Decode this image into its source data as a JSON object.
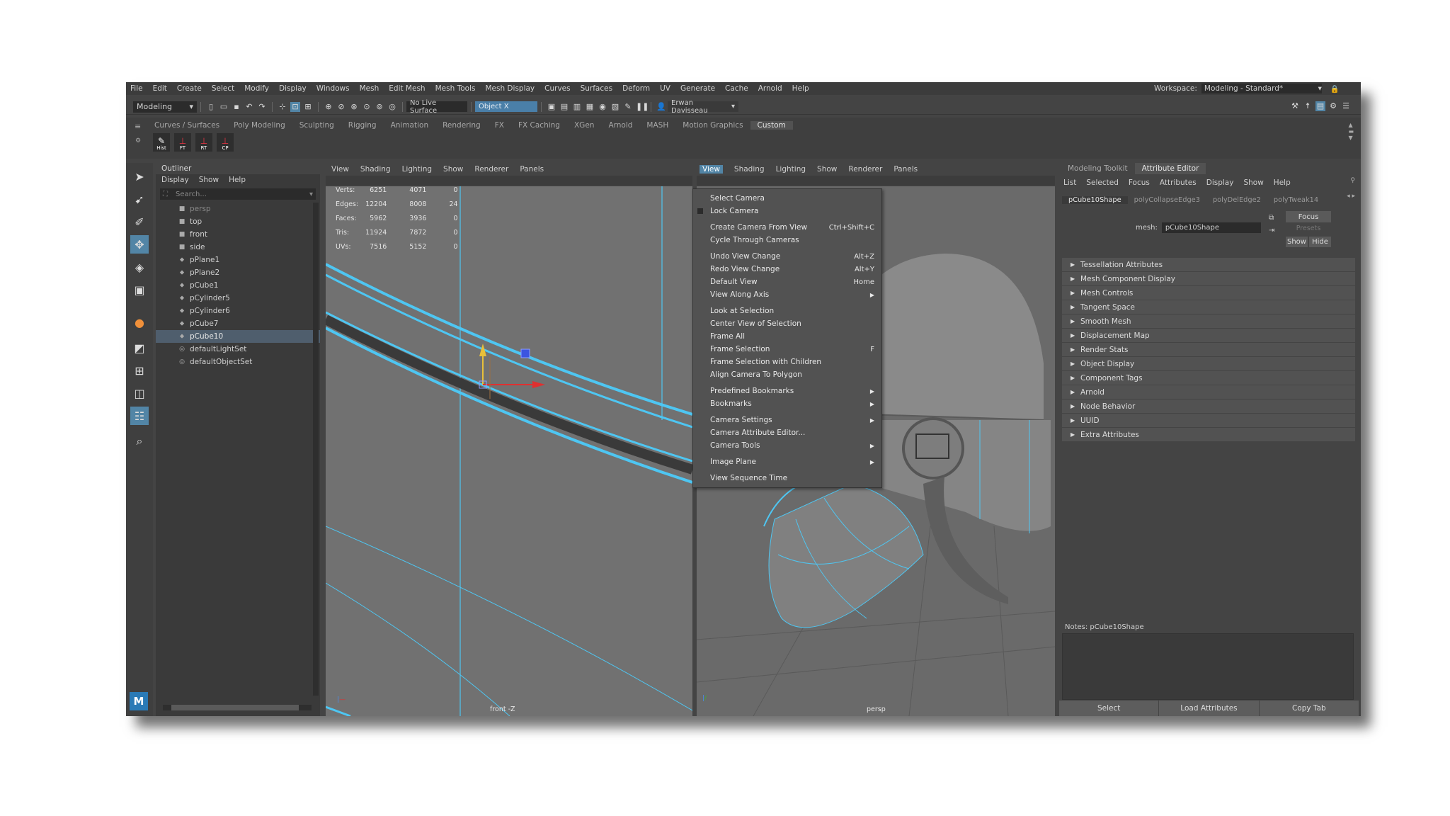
{
  "menubar": [
    "File",
    "Edit",
    "Create",
    "Select",
    "Modify",
    "Display",
    "Windows",
    "Mesh",
    "Edit Mesh",
    "Mesh Tools",
    "Mesh Display",
    "Curves",
    "Surfaces",
    "Deform",
    "UV",
    "Generate",
    "Cache",
    "Arnold",
    "Help"
  ],
  "workspace": {
    "label": "Workspace:",
    "value": "Modeling - Standard*"
  },
  "statusline": {
    "menuset": "Modeling",
    "live_surface": "No Live Surface",
    "symmetry": "Object X",
    "user": "Erwan Davisseau"
  },
  "shelf": {
    "tabs": [
      "Curves / Surfaces",
      "Poly Modeling",
      "Sculpting",
      "Rigging",
      "Animation",
      "Rendering",
      "FX",
      "FX Caching",
      "XGen",
      "Arnold",
      "MASH",
      "Motion Graphics",
      "Custom"
    ],
    "buttons": [
      "Hist",
      "FT",
      "RT",
      "CP"
    ]
  },
  "outliner": {
    "title": "Outliner",
    "menu": [
      "Display",
      "Show",
      "Help"
    ],
    "search_placeholder": "Search...",
    "items": [
      "persp",
      "top",
      "front",
      "side",
      "pPlane1",
      "pPlane2",
      "pCube1",
      "pCylinder5",
      "pCylinder6",
      "pCube7",
      "pCube10",
      "defaultLightSet",
      "defaultObjectSet"
    ]
  },
  "viewport_left": {
    "menu": [
      "View",
      "Shading",
      "Lighting",
      "Show",
      "Renderer",
      "Panels"
    ],
    "hud": [
      {
        "label": "Verts:",
        "a": "6251",
        "b": "4071",
        "c": "0"
      },
      {
        "label": "Edges:",
        "a": "12204",
        "b": "8008",
        "c": "24"
      },
      {
        "label": "Faces:",
        "a": "5962",
        "b": "3936",
        "c": "0"
      },
      {
        "label": "Tris:",
        "a": "11924",
        "b": "7872",
        "c": "0"
      },
      {
        "label": "UVs:",
        "a": "7516",
        "b": "5152",
        "c": "0"
      }
    ],
    "camera_label": "front -Z"
  },
  "viewport_right": {
    "menu": [
      "View",
      "Shading",
      "Lighting",
      "Show",
      "Renderer",
      "Panels"
    ],
    "camera_label": "persp"
  },
  "view_menu": {
    "groups": [
      [
        {
          "label": "Select Camera",
          "shortcut": ""
        },
        {
          "label": "Lock Camera",
          "shortcut": ""
        }
      ],
      [
        {
          "label": "Create Camera From View",
          "shortcut": "Ctrl+Shift+C"
        },
        {
          "label": "Cycle Through Cameras",
          "shortcut": ""
        }
      ],
      [
        {
          "label": "Undo View Change",
          "shortcut": "Alt+Z"
        },
        {
          "label": "Redo View Change",
          "shortcut": "Alt+Y"
        },
        {
          "label": "Default View",
          "shortcut": "Home"
        },
        {
          "label": "View Along Axis",
          "shortcut": "",
          "sub": true
        }
      ],
      [
        {
          "label": "Look at Selection",
          "shortcut": ""
        },
        {
          "label": "Center View of Selection",
          "shortcut": ""
        },
        {
          "label": "Frame All",
          "shortcut": ""
        },
        {
          "label": "Frame Selection",
          "shortcut": "F"
        },
        {
          "label": "Frame Selection with Children",
          "shortcut": ""
        },
        {
          "label": "Align Camera To Polygon",
          "shortcut": ""
        }
      ],
      [
        {
          "label": "Predefined Bookmarks",
          "shortcut": "",
          "sub": true
        },
        {
          "label": "Bookmarks",
          "shortcut": "",
          "sub": true
        }
      ],
      [
        {
          "label": "Camera Settings",
          "shortcut": "",
          "sub": true
        },
        {
          "label": "Camera Attribute Editor...",
          "shortcut": ""
        },
        {
          "label": "Camera Tools",
          "shortcut": "",
          "sub": true
        }
      ],
      [
        {
          "label": "Image Plane",
          "shortcut": "",
          "sub": true
        }
      ],
      [
        {
          "label": "View Sequence Time",
          "shortcut": ""
        }
      ]
    ]
  },
  "attribute_editor": {
    "tabs": [
      "Modeling Toolkit",
      "Attribute Editor"
    ],
    "menu": [
      "List",
      "Selected",
      "Focus",
      "Attributes",
      "Display",
      "Show",
      "Help"
    ],
    "node_tabs": [
      "pCube10Shape",
      "polyCollapseEdge3",
      "polyDelEdge2",
      "polyTweak14"
    ],
    "mesh_label": "mesh:",
    "mesh_value": "pCube10Shape",
    "focus": "Focus",
    "presets": "Presets",
    "show": "Show",
    "hide": "Hide",
    "sections": [
      "Tessellation Attributes",
      "Mesh Component Display",
      "Mesh Controls",
      "Tangent Space",
      "Smooth Mesh",
      "Displacement Map",
      "Render Stats",
      "Object Display",
      "Component Tags",
      "Arnold",
      "Node Behavior",
      "UUID",
      "Extra Attributes"
    ],
    "notes": "Notes:  pCube10Shape",
    "buttons": [
      "Select",
      "Load Attributes",
      "Copy Tab"
    ]
  },
  "colors": {
    "wire": "#4ec6f2",
    "selection": "#5285a6",
    "menu_bg": "#525252"
  }
}
